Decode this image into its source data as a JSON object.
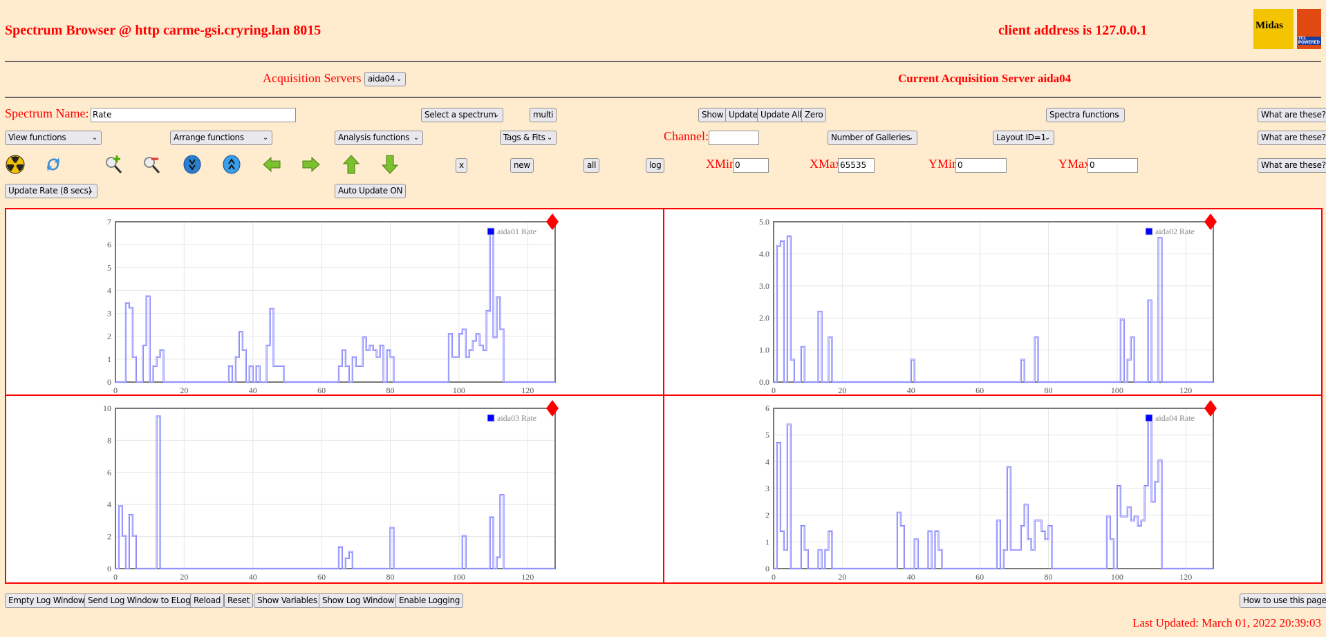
{
  "header": {
    "title": "Spectrum Browser @ http carme-gsi.cryring.lan 8015",
    "client": "client address is 127.0.0.1",
    "logo1_text": "Midas",
    "logo2_text": "TCL POWERED"
  },
  "acq": {
    "label": "Acquisition Servers",
    "selected": "aida04",
    "current": "Current Acquisition Server aida04"
  },
  "row1": {
    "spectrum_name_label": "Spectrum Name:",
    "spectrum_name_value": "Rate",
    "select_spectrum": "Select a spectrum",
    "multi": "multi",
    "show": "Show",
    "update": "Update",
    "update_all": "Update All",
    "zero": "Zero",
    "spectra_functions": "Spectra functions",
    "what": "What are these?"
  },
  "row2": {
    "view": "View functions",
    "arrange": "Arrange functions",
    "analysis": "Analysis functions",
    "tags": "Tags & Fits",
    "channel_label": "Channel:",
    "channel_value": "",
    "galleries": "Number of Galleries",
    "layout": "Layout ID=1",
    "what": "What are these?"
  },
  "row3": {
    "icons": [
      "radiation-icon",
      "refresh-icon",
      "zoom-in-icon",
      "zoom-out-icon",
      "expand-down-icon",
      "expand-up-icon",
      "arrow-left-icon",
      "arrow-right-icon",
      "arrow-up-icon",
      "arrow-down-icon"
    ],
    "x": "x",
    "new": "new",
    "all": "all",
    "log": "log",
    "xmin_label": "XMin",
    "xmin": "0",
    "xmax_label": "XMax",
    "xmax": "65535",
    "ymin_label": "YMin",
    "ymin": "0",
    "ymax_label": "YMax",
    "ymax": "0",
    "what": "What are these?"
  },
  "row4": {
    "update_rate": "Update Rate (8 secs)",
    "auto_update": "Auto Update ON"
  },
  "footer": {
    "buttons": [
      "Empty Log Window",
      "Send Log Window to ELog",
      "Reload",
      "Reset",
      "Show Variables",
      "Show Log Window",
      "Enable Logging"
    ],
    "howto": "How to use this page",
    "last_updated": "Last Updated: March 01, 2022 20:39:03"
  },
  "colors": {
    "accent": "#ff0000",
    "line": "#0000ff",
    "background": "#ffebcd"
  },
  "chart_data": [
    {
      "type": "line",
      "step": true,
      "legend": "aida01 Rate",
      "legend_position": "top-right",
      "xlim": [
        0,
        128
      ],
      "ylim": [
        0,
        7
      ],
      "xticks": [
        "0",
        "20",
        "40",
        "60",
        "80",
        "100",
        "120"
      ],
      "yticks": [
        "0",
        "1",
        "2",
        "3",
        "4",
        "5",
        "6",
        "7"
      ],
      "grid": true,
      "bins": [
        [
          3,
          3.45
        ],
        [
          4,
          3.25
        ],
        [
          5,
          1.1
        ],
        [
          8,
          1.6
        ],
        [
          9,
          3.75
        ],
        [
          11,
          0.7
        ],
        [
          12,
          1.1
        ],
        [
          13,
          1.4
        ],
        [
          33,
          0.7
        ],
        [
          35,
          1.1
        ],
        [
          36,
          2.2
        ],
        [
          37,
          1.4
        ],
        [
          39,
          0.7
        ],
        [
          41,
          0.7
        ],
        [
          44,
          1.6
        ],
        [
          45,
          3.2
        ],
        [
          46,
          0.7
        ],
        [
          47,
          0.7
        ],
        [
          48,
          0.7
        ],
        [
          65,
          0.7
        ],
        [
          66,
          1.4
        ],
        [
          67,
          0.7
        ],
        [
          69,
          1.1
        ],
        [
          70,
          0.7
        ],
        [
          71,
          0.7
        ],
        [
          72,
          1.95
        ],
        [
          73,
          1.4
        ],
        [
          74,
          1.6
        ],
        [
          75,
          1.4
        ],
        [
          76,
          1.1
        ],
        [
          77,
          1.6
        ],
        [
          79,
          1.4
        ],
        [
          80,
          1.1
        ],
        [
          97,
          2.1
        ],
        [
          98,
          1.1
        ],
        [
          99,
          1.1
        ],
        [
          100,
          2.1
        ],
        [
          101,
          2.3
        ],
        [
          102,
          1.1
        ],
        [
          103,
          1.4
        ],
        [
          104,
          1.8
        ],
        [
          105,
          2.1
        ],
        [
          106,
          1.6
        ],
        [
          107,
          1.4
        ],
        [
          108,
          3.1
        ],
        [
          109,
          6.5
        ],
        [
          110,
          1.95
        ],
        [
          111,
          3.7
        ],
        [
          112,
          2.3
        ]
      ]
    },
    {
      "type": "line",
      "step": true,
      "legend": "aida02 Rate",
      "legend_position": "top-right",
      "xlim": [
        0,
        128
      ],
      "ylim": [
        0,
        5
      ],
      "xticks": [
        "0",
        "20",
        "40",
        "60",
        "80",
        "100",
        "120"
      ],
      "yticks": [
        "0.0",
        "1.0",
        "2.0",
        "3.0",
        "4.0",
        "5.0"
      ],
      "grid": true,
      "bins": [
        [
          1,
          4.25
        ],
        [
          2,
          4.4
        ],
        [
          4,
          4.55
        ],
        [
          5,
          0.7
        ],
        [
          8,
          1.1
        ],
        [
          13,
          2.2
        ],
        [
          16,
          1.4
        ],
        [
          40,
          0.7
        ],
        [
          72,
          0.7
        ],
        [
          76,
          1.4
        ],
        [
          101,
          1.95
        ],
        [
          103,
          0.7
        ],
        [
          104,
          1.4
        ],
        [
          109,
          2.55
        ],
        [
          112,
          4.5
        ]
      ]
    },
    {
      "type": "line",
      "step": true,
      "legend": "aida03 Rate",
      "legend_position": "top-right",
      "xlim": [
        0,
        128
      ],
      "ylim": [
        0,
        10
      ],
      "xticks": [
        "0",
        "20",
        "40",
        "60",
        "80",
        "100",
        "120"
      ],
      "yticks": [
        "0",
        "2",
        "4",
        "6",
        "8",
        "10"
      ],
      "grid": true,
      "bins": [
        [
          1,
          3.9
        ],
        [
          2,
          2.05
        ],
        [
          4,
          3.35
        ],
        [
          5,
          2.05
        ],
        [
          12,
          9.5
        ],
        [
          65,
          1.35
        ],
        [
          67,
          0.65
        ],
        [
          68,
          1.05
        ],
        [
          80,
          2.55
        ],
        [
          101,
          2.05
        ],
        [
          109,
          3.2
        ],
        [
          111,
          0.7
        ],
        [
          112,
          4.6
        ]
      ]
    },
    {
      "type": "line",
      "step": true,
      "legend": "aida04 Rate",
      "legend_position": "top-right",
      "xlim": [
        0,
        128
      ],
      "ylim": [
        0,
        6
      ],
      "xticks": [
        "0",
        "20",
        "40",
        "60",
        "80",
        "100",
        "120"
      ],
      "yticks": [
        "0",
        "1",
        "2",
        "3",
        "4",
        "5",
        "6"
      ],
      "grid": true,
      "bins": [
        [
          1,
          4.7
        ],
        [
          2,
          1.4
        ],
        [
          3,
          0.7
        ],
        [
          4,
          5.4
        ],
        [
          8,
          1.6
        ],
        [
          9,
          0.7
        ],
        [
          13,
          0.7
        ],
        [
          15,
          0.7
        ],
        [
          16,
          1.4
        ],
        [
          36,
          2.1
        ],
        [
          37,
          1.6
        ],
        [
          41,
          1.1
        ],
        [
          45,
          1.4
        ],
        [
          47,
          1.4
        ],
        [
          48,
          0.7
        ],
        [
          65,
          1.8
        ],
        [
          67,
          0.7
        ],
        [
          68,
          3.8
        ],
        [
          69,
          0.7
        ],
        [
          70,
          0.7
        ],
        [
          71,
          0.7
        ],
        [
          72,
          1.6
        ],
        [
          73,
          2.4
        ],
        [
          74,
          1.1
        ],
        [
          75,
          0.7
        ],
        [
          76,
          1.8
        ],
        [
          77,
          1.8
        ],
        [
          78,
          1.4
        ],
        [
          79,
          1.1
        ],
        [
          80,
          1.6
        ],
        [
          97,
          1.95
        ],
        [
          98,
          1.1
        ],
        [
          100,
          3.1
        ],
        [
          101,
          1.95
        ],
        [
          102,
          1.95
        ],
        [
          103,
          2.3
        ],
        [
          104,
          1.8
        ],
        [
          105,
          1.95
        ],
        [
          106,
          1.6
        ],
        [
          107,
          1.8
        ],
        [
          108,
          3.1
        ],
        [
          109,
          5.7
        ],
        [
          110,
          2.5
        ],
        [
          111,
          3.25
        ],
        [
          112,
          4.05
        ]
      ]
    }
  ]
}
